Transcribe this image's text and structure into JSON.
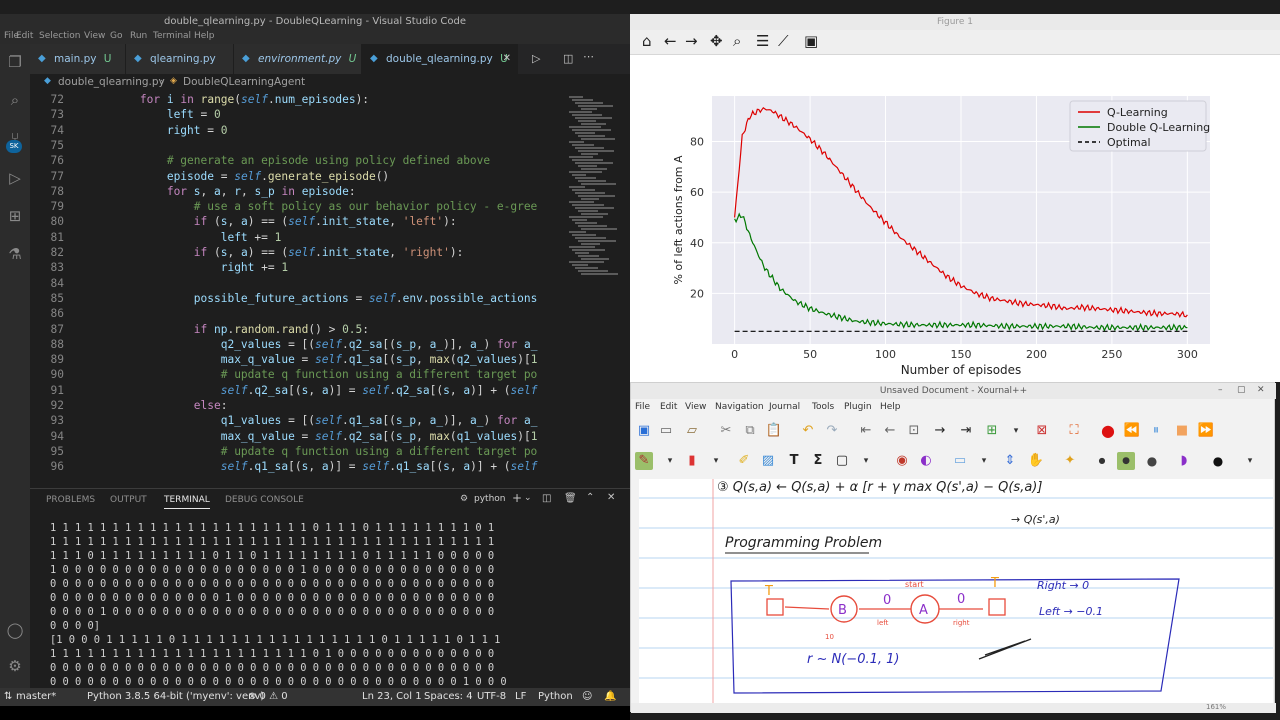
{
  "vscode": {
    "title": "double_qlearning.py - DoubleQLearning - Visual Studio Code",
    "menu": [
      "File",
      "Edit",
      "Selection",
      "View",
      "Go",
      "Run",
      "Terminal",
      "Help"
    ],
    "tabs": [
      {
        "label": "main.py",
        "badge": "U"
      },
      {
        "label": "qlearning.py",
        "badge": ""
      },
      {
        "label": "environment.py",
        "badge": "U"
      },
      {
        "label": "double_qlearning.py",
        "badge": "U"
      }
    ],
    "breadcrumb": {
      "file": "double_qlearning.py",
      "symbol": "DoubleQLearningAgent"
    },
    "account_badge": "SK",
    "panel_tabs": [
      "PROBLEMS",
      "OUTPUT",
      "TERMINAL",
      "DEBUG CONSOLE"
    ],
    "terminal_shell": "python",
    "terminal_lines": [
      "1 1 1 1 1 1 1 1 1 1 1 1 1 1 1 1 1 1 1 1 1 0 1 1 1 0 1 1 1 1 1 1 1 1 0 1",
      "1 1 1 1 1 1 1 1 1 1 1 1 1 1 1 1 1 1 1 1 1 1 1 1 1 1 1 1 1 1 1 1 1 1 1 1",
      "1 1 1 0 1 1 1 1 1 1 1 1 1 0 1 1 0 1 1 1 1 1 1 1 1 0 1 1 1 1 1 0 0 0 0 0",
      "1 0 0 0 0 0 0 0 0 0 0 0 0 0 0 0 0 0 0 0 1 0 0 0 0 0 0 0 0 0 0 0 0 0 0 0",
      "0 0 0 0 0 0 0 0 0 0 0 0 0 0 0 0 0 0 0 0 0 0 0 0 0 0 0 0 0 0 0 0 0 0 0 0",
      "0 0 0 0 0 0 0 0 0 0 0 0 0 0 1 0 0 0 0 0 0 0 0 0 0 0 0 0 0 0 0 0 0 0 0 0",
      "0 0 0 0 1 0 0 0 0 0 0 0 0 0 0 0 0 0 0 0 0 0 0 0 0 0 0 0 0 0 0 0 0 0 0 0",
      "0 0 0 0]",
      "[1 0 0 0 1 1 1 1 1 0 1 1 1 1 1 1 1 1 1 1 1 1 1 1 1 1 0 1 1 1 1 1 0 1 1 1",
      "1 1 1 1 1 1 1 1 1 1 1 1 1 1 1 1 1 1 1 1 1 0 1 0 0 0 0 0 0 0 0 0 0 0 0 0",
      "0 0 0 0 0 0 0 0 0 0 0 0 0 0 0 0 0 0 0 0 0 0 0 0 0 0 0 0 0 0 0 0 0 0 0 0",
      "0 0 0 0 0 0 0 0 0 0 0 0 0 0 0 0 0 0 0 0 0 0 0 0 0 0 0 0 0 0 0 0 0 1 0 0 0",
      "0 0 0 0 0 0 0 0 0 0 0 0 0 0 0 0 0 0 0 0 0 0 0 0 0 0 0 0 0 0 0 0 0 0 0 0"
    ],
    "status": {
      "branch": "master*",
      "interpreter": "Python 3.8.5 64-bit ('myenv': venv)",
      "problems": "⊗ 0 ⚠ 0",
      "position": "Ln 23, Col 1",
      "spaces": "Spaces: 4",
      "encoding": "UTF-8",
      "eol": "LF",
      "language": "Python"
    },
    "code_lines": [
      {
        "n": "72",
        "html": "        <span class='kw'>for</span> <span class='var'>i</span> <span class='kw'>in</span> <span class='fn'>range</span>(<span class='sf'>self</span>.<span class='var'>num_episodes</span>):"
      },
      {
        "n": "73",
        "html": "            <span class='var'>left</span> = <span class='num'>0</span>"
      },
      {
        "n": "74",
        "html": "            <span class='var'>right</span> = <span class='num'>0</span>"
      },
      {
        "n": "75",
        "html": ""
      },
      {
        "n": "76",
        "html": "            <span class='cm'># generate an episode using policy defined above</span>"
      },
      {
        "n": "77",
        "html": "            <span class='var'>episode</span> = <span class='sf'>self</span>.<span class='fn'>generate_episode</span>()"
      },
      {
        "n": "78",
        "html": "            <span class='kw'>for</span> <span class='var'>s</span>, <span class='var'>a</span>, <span class='var'>r</span>, <span class='var'>s_p</span> <span class='kw'>in</span> <span class='var'>episode</span>:"
      },
      {
        "n": "79",
        "html": "                <span class='cm'># use a soft policy as our behavior policy - e-gree</span>"
      },
      {
        "n": "80",
        "html": "                <span class='kw'>if</span> (<span class='var'>s</span>, <span class='var'>a</span>) == (<span class='sf'>self</span>.<span class='var'>init_state</span>, <span class='str'>'left'</span>):"
      },
      {
        "n": "81",
        "html": "                    <span class='var'>left</span> += <span class='num'>1</span>"
      },
      {
        "n": "82",
        "html": "                <span class='kw'>if</span> (<span class='var'>s</span>, <span class='var'>a</span>) == (<span class='sf'>self</span>.<span class='var'>init_state</span>, <span class='str'>'right'</span>):"
      },
      {
        "n": "83",
        "html": "                    <span class='var'>right</span> += <span class='num'>1</span>"
      },
      {
        "n": "84",
        "html": ""
      },
      {
        "n": "85",
        "html": "                <span class='var'>possible_future_actions</span> = <span class='sf'>self</span>.<span class='var'>env</span>.<span class='var'>possible_actions</span>"
      },
      {
        "n": "86",
        "html": ""
      },
      {
        "n": "87",
        "html": "                <span class='kw'>if</span> <span class='var'>np</span>.<span class='fn'>random</span>.<span class='fn'>rand</span>() &gt; <span class='num'>0.5</span>:"
      },
      {
        "n": "88",
        "html": "                    <span class='var'>q2_values</span> = [(<span class='sf'>self</span>.<span class='var'>q2_sa</span>[(<span class='var'>s_p</span>, <span class='var'>a_</span>)], <span class='var'>a_</span>) <span class='kw'>for</span> <span class='var'>a_</span>"
      },
      {
        "n": "89",
        "html": "                    <span class='var'>max_q_value</span> = <span class='sf'>self</span>.<span class='var'>q1_sa</span>[(<span class='var'>s_p</span>, <span class='fn'>max</span>(<span class='var'>q2_values</span>)[<span class='num'>1</span>"
      },
      {
        "n": "90",
        "html": "                    <span class='cm'># update q function using a different target po</span>"
      },
      {
        "n": "91",
        "html": "                    <span class='sf'>self</span>.<span class='var'>q2_sa</span>[(<span class='var'>s</span>, <span class='var'>a</span>)] = <span class='sf'>self</span>.<span class='var'>q2_sa</span>[(<span class='var'>s</span>, <span class='var'>a</span>)] + (<span class='sf'>self</span>"
      },
      {
        "n": "92",
        "html": "                <span class='kw'>else</span>:"
      },
      {
        "n": "93",
        "html": "                    <span class='var'>q1_values</span> = [(<span class='sf'>self</span>.<span class='var'>q1_sa</span>[(<span class='var'>s_p</span>, <span class='var'>a_</span>)], <span class='var'>a_</span>) <span class='kw'>for</span> <span class='var'>a_</span>"
      },
      {
        "n": "94",
        "html": "                    <span class='var'>max_q_value</span> = <span class='sf'>self</span>.<span class='var'>q2_sa</span>[(<span class='var'>s_p</span>, <span class='fn'>max</span>(<span class='var'>q1_values</span>)[<span class='num'>1</span>"
      },
      {
        "n": "95",
        "html": "                    <span class='cm'># update q function using a different target po</span>"
      },
      {
        "n": "96",
        "html": "                    <span class='sf'>self</span>.<span class='var'>q1_sa</span>[(<span class='var'>s</span>, <span class='var'>a</span>)] = <span class='sf'>self</span>.<span class='var'>q1_sa</span>[(<span class='var'>s</span>, <span class='var'>a</span>)] + (<span class='sf'>self</span>"
      }
    ]
  },
  "figure": {
    "title": "Figure 1",
    "toolbar_icons": [
      "home-icon",
      "back-icon",
      "forward-icon",
      "pan-icon",
      "zoom-icon",
      "configure-icon",
      "edit-axis-icon",
      "save-icon"
    ]
  },
  "chart_data": {
    "type": "line",
    "title": "",
    "xlabel": "Number of episodes",
    "ylabel": "% of left actions from A",
    "xlim": [
      -15,
      315
    ],
    "ylim": [
      0,
      98
    ],
    "xticks": [
      0,
      50,
      100,
      150,
      200,
      250,
      300
    ],
    "yticks": [
      20,
      40,
      60,
      80
    ],
    "grid": true,
    "legend_position": "top-right",
    "series": [
      {
        "name": "Q-Learning",
        "color": "#dd0000",
        "x": [
          0,
          5,
          10,
          15,
          20,
          25,
          30,
          40,
          50,
          60,
          70,
          80,
          90,
          100,
          110,
          120,
          130,
          140,
          150,
          160,
          170,
          180,
          190,
          200,
          210,
          220,
          230,
          240,
          250,
          260,
          270,
          280,
          290,
          300
        ],
        "y": [
          50,
          82,
          90,
          92,
          93,
          92,
          90,
          86,
          81,
          75,
          68,
          61,
          54,
          48,
          42,
          37,
          32,
          27,
          23,
          20,
          18,
          17,
          16,
          15.5,
          15,
          14,
          14.5,
          14,
          13.5,
          13,
          12.5,
          12,
          12,
          11.5
        ]
      },
      {
        "name": "Double Q-Learning",
        "color": "#007700",
        "x": [
          0,
          5,
          10,
          15,
          20,
          25,
          30,
          40,
          50,
          60,
          70,
          80,
          90,
          100,
          120,
          140,
          160,
          180,
          200,
          220,
          240,
          260,
          280,
          300
        ],
        "y": [
          49,
          51,
          43,
          36,
          30,
          26,
          22,
          17,
          14,
          12,
          10.5,
          9,
          8.5,
          8,
          7.5,
          7.5,
          7.5,
          7,
          7,
          7,
          6.5,
          6.5,
          6.5,
          6.5
        ]
      },
      {
        "name": "Optimal",
        "color": "#000000",
        "dashed": true,
        "x": [
          0,
          300
        ],
        "y": [
          5,
          5
        ]
      }
    ]
  },
  "xournal": {
    "title": "Unsaved Document - Xournal++",
    "menu": [
      "File",
      "Edit",
      "View",
      "Navigation",
      "Journal",
      "Tools",
      "Plugin",
      "Help"
    ],
    "zoom": "161%",
    "handwriting": {
      "equation": "③ Q(s,a) ← Q(s,a) + α [r + γ max Q(s',a) − Q(s,a)]",
      "equation_note": "→ Q(s',a)",
      "heading": "Programming Problem",
      "right_note": "Right → 0",
      "left_note": "Left → −0.1",
      "state_b": "B",
      "state_a": "A",
      "start_label": "start",
      "terminal_left": "T",
      "terminal_right": "T",
      "edge_left": "left",
      "edge_right": "right",
      "reward_b": "0",
      "reward_a": "0",
      "dist_note": "r ~ N(−0.1, 1)",
      "count_label": "10"
    }
  }
}
